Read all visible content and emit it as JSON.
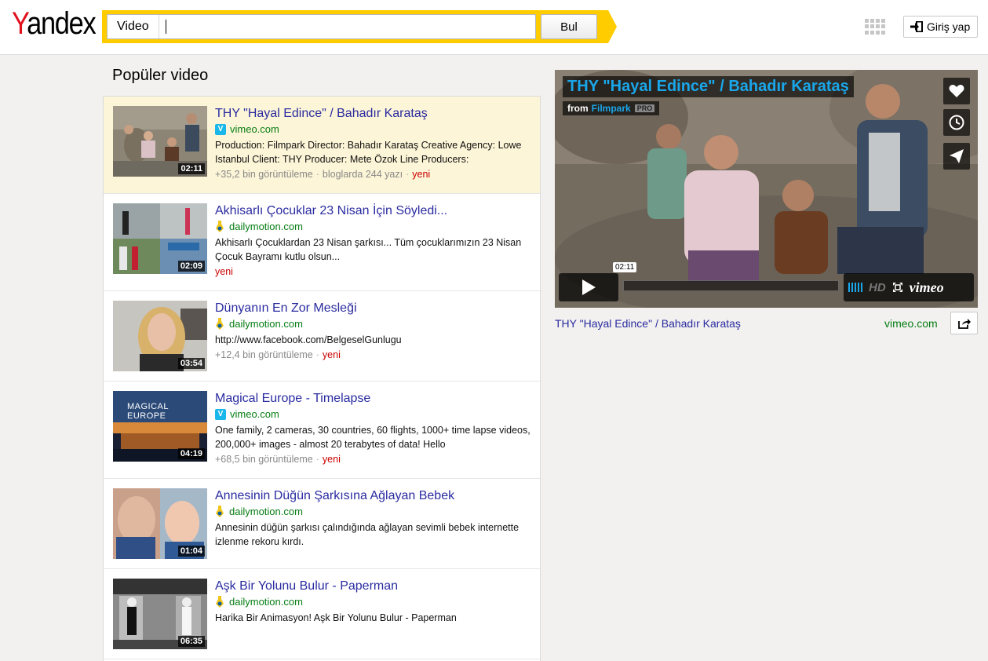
{
  "header": {
    "logo": "Yandex",
    "search_tag": "Video",
    "search_value": "",
    "search_button": "Bul",
    "login_button": "Giriş yap"
  },
  "section_title": "Popüler video",
  "videos": [
    {
      "title": "THY \"Hayal Edince\" / Bahadır Karataş",
      "host": "vimeo.com",
      "host_icon": "vimeo-icon",
      "duration": "02:11",
      "desc": "Production: Filmpark Director: Bahadır Karataş Creative Agency: Lowe Istanbul Client: THY Producer: Mete Özok Line Producers:",
      "views": "+35,2 bin görüntüleme",
      "blogs": "bloglarda 244 yazı",
      "badge": "yeni"
    },
    {
      "title": "Akhisarlı Çocuklar 23 Nisan İçin Söyledi...",
      "host": "dailymotion.com",
      "host_icon": "dailymotion-icon",
      "duration": "02:09",
      "desc": "Akhisarlı Çocuklardan 23 Nisan şarkısı... Tüm çocuklarımızın 23 Nisan Çocuk Bayramı kutlu olsun...",
      "badge": "yeni"
    },
    {
      "title": "Dünyanın En Zor Mesleği",
      "host": "dailymotion.com",
      "host_icon": "dailymotion-icon",
      "duration": "03:54",
      "desc": "http://www.facebook.com/BelgeselGunlugu",
      "views": "+12,4 bin görüntüleme",
      "badge": "yeni"
    },
    {
      "title": "Magical Europe - Timelapse",
      "host": "vimeo.com",
      "host_icon": "vimeo-icon",
      "duration": "04:19",
      "thumb_text": "MAGICAL EUROPE",
      "desc": "One family, 2 cameras, 30 countries, 60 flights, 1000+ time lapse videos, 200,000+ images - almost 20 terabytes of data! Hello",
      "views": "+68,5 bin görüntüleme",
      "badge": "yeni"
    },
    {
      "title": "Annesinin Düğün Şarkısına Ağlayan Bebek",
      "host": "dailymotion.com",
      "host_icon": "dailymotion-icon",
      "duration": "01:04",
      "desc": "Annesinin düğün şarkısı çalındığında ağlayan sevimli bebek internette izlenme rekoru kırdı."
    },
    {
      "title": "Aşk Bir Yolunu Bulur - Paperman",
      "host": "dailymotion.com",
      "host_icon": "dailymotion-icon",
      "duration": "06:35",
      "desc": "Harika Bir Animasyon! Aşk Bir Yolunu Bulur - Paperman"
    }
  ],
  "player": {
    "title": "THY \"Hayal Edince\" / Bahadır Karataş",
    "from_label": "from",
    "from_link": "Filmpark",
    "pro_badge": "PRO",
    "time_tooltip": "02:11",
    "progress": 0.0,
    "hd_label": "HD",
    "brand": "vimeo",
    "caption": "THY \"Hayal Edince\" / Bahadır Karataş",
    "host": "vimeo.com"
  },
  "colors": {
    "link": "#2a2ba0",
    "host": "#067d13",
    "new": "#cc0000",
    "active_row": "#fcf5d7",
    "search_frame": "#ffcc00",
    "vimeo_blue": "#1aa7ea"
  }
}
